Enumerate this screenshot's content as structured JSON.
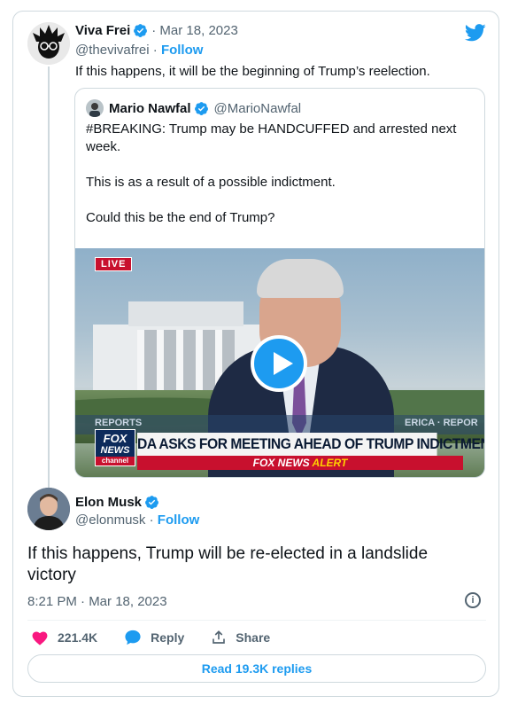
{
  "parent_tweet": {
    "name": "Viva Frei",
    "date": "· Mar 18, 2023",
    "handle": "@thevivafrei",
    "separator": " · ",
    "follow_label": "Follow",
    "text": "If this happens, it will be the beginning of Trump’s reelection."
  },
  "quoted_tweet": {
    "name": "Mario Nawfal",
    "handle": "@MarioNawfal",
    "line1": "#BREAKING: Trump may be HANDCUFFED and arrested next week.",
    "line2": "This is as a result of a possible indictment.",
    "line3": "Could this be the end of Trump?"
  },
  "video": {
    "live_badge": "LIVE",
    "reports_left": "REPORTS",
    "reports_right": "ERICA · REPOR",
    "logo_line1": "FOX",
    "logo_line2": "NEWS",
    "logo_line3": "channel",
    "headline": "DA ASKS FOR MEETING AHEAD OF TRUMP INDICTMENT",
    "alert_brand": "FOX NEWS ",
    "alert_word": "ALERT"
  },
  "main_tweet": {
    "name": "Elon Musk",
    "handle": "@elonmusk",
    "separator": " · ",
    "follow_label": "Follow",
    "text": "If this happens, Trump will be re-elected in a landslide victory",
    "timestamp": "8:21 PM · Mar 18, 2023",
    "info_glyph": "i"
  },
  "actions": {
    "likes": "221.4K",
    "reply_label": "Reply",
    "share_label": "Share"
  },
  "read_replies_label": "Read 19.3K replies",
  "colors": {
    "accent": "#1d9bf0",
    "like": "#f91880",
    "muted": "#536471",
    "border": "#cfd9de"
  }
}
